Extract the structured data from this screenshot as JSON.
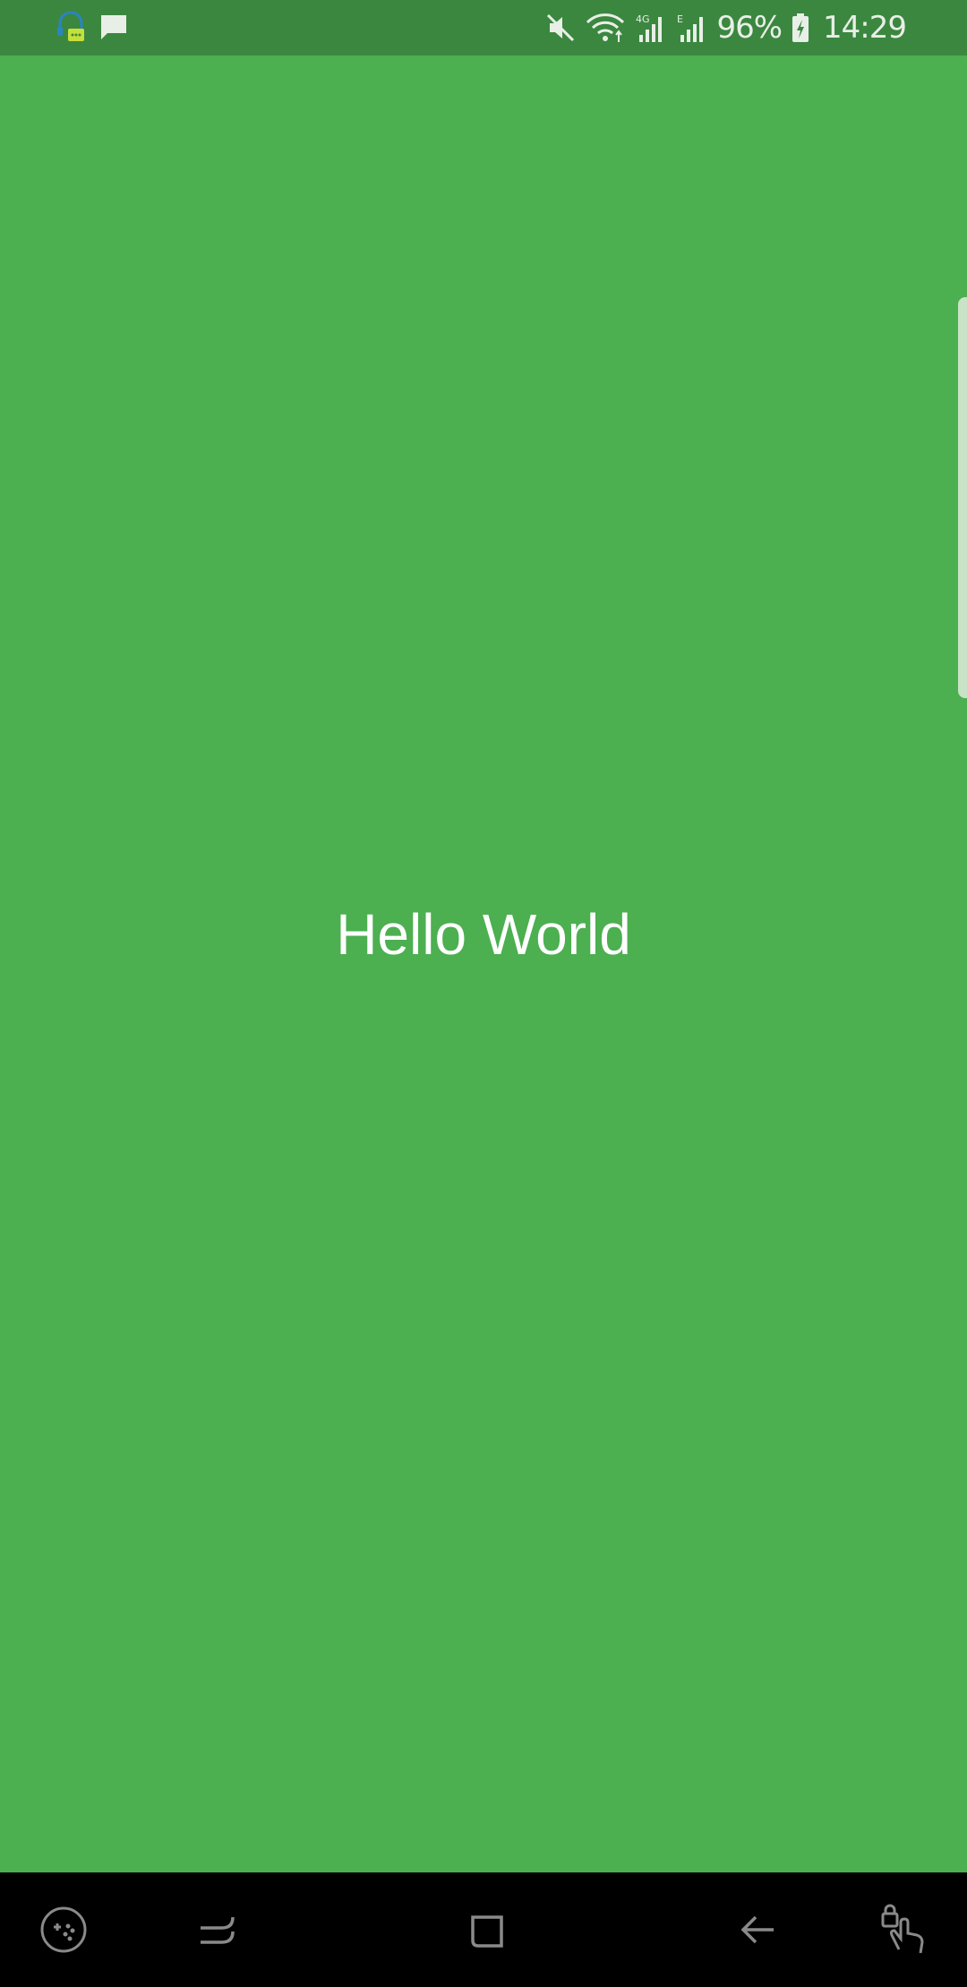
{
  "status_bar": {
    "left_icons": [
      "headset-notification-icon",
      "message-icon"
    ],
    "right_icons": [
      "mute-icon",
      "wifi-icon",
      "signal-4g-icon",
      "signal-e-icon",
      "battery-charging-icon"
    ],
    "battery_percent": "96%",
    "time": "14:29"
  },
  "main": {
    "text": "Hello World"
  },
  "nav_bar": {
    "buttons": [
      "game-tools-icon",
      "recent-apps-icon",
      "home-icon",
      "back-icon",
      "touch-lock-icon"
    ]
  },
  "colors": {
    "background": "#4caf50",
    "status_bar": "#3b8740",
    "nav_bar": "#000000",
    "text": "#ffffff"
  }
}
